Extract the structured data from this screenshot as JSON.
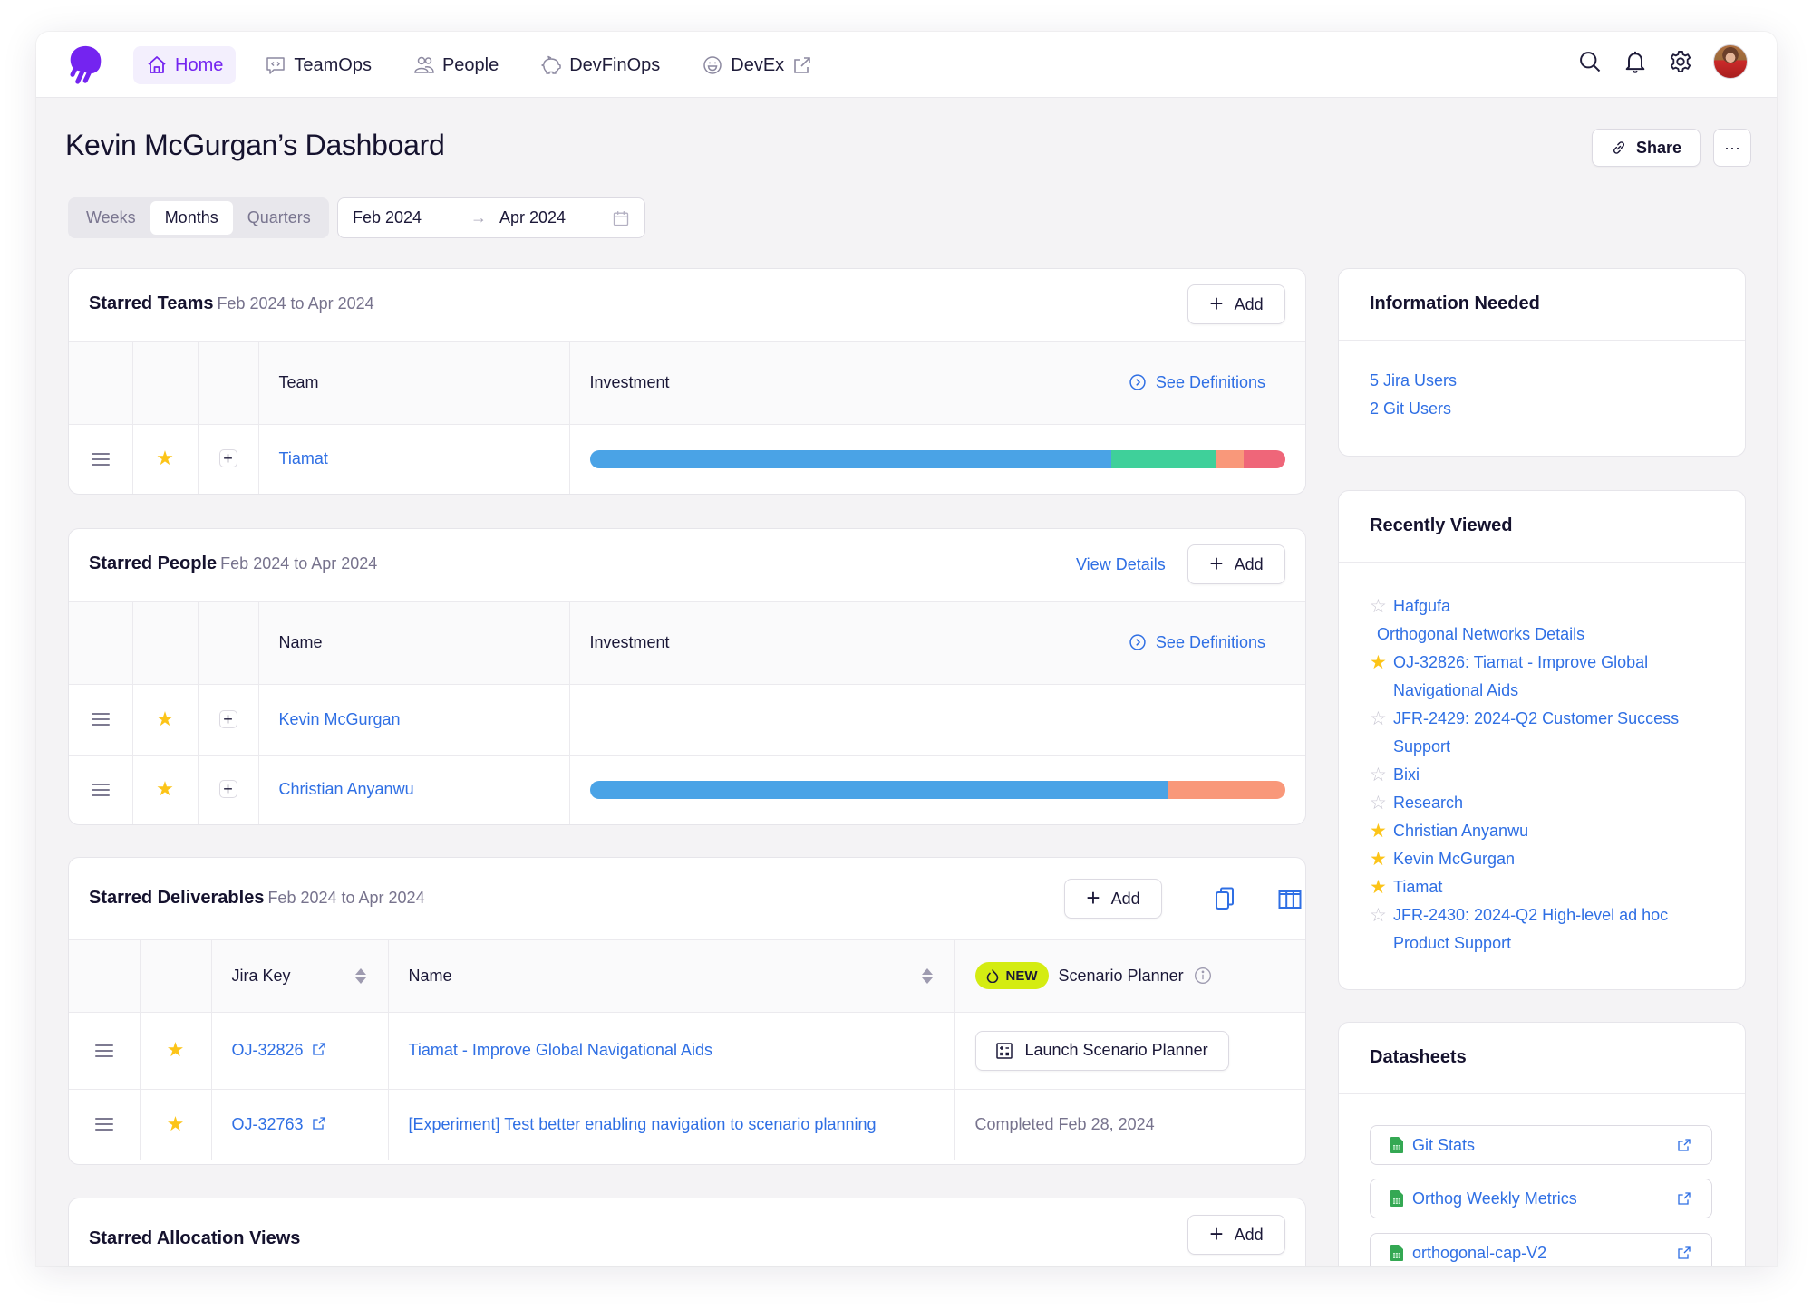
{
  "nav": {
    "items": [
      {
        "label": "Home",
        "icon": "home-icon",
        "active": true
      },
      {
        "label": "TeamOps",
        "icon": "code-chat-icon",
        "active": false
      },
      {
        "label": "People",
        "icon": "people-icon",
        "active": false
      },
      {
        "label": "DevFinOps",
        "icon": "piggy-bank-icon",
        "active": false
      },
      {
        "label": "DevEx",
        "icon": "smiley-icon",
        "active": false,
        "external": true
      }
    ],
    "right_icons": [
      "search-icon",
      "bell-icon",
      "gear-icon",
      "avatar"
    ]
  },
  "page": {
    "title": "Kevin McGurgan’s Dashboard",
    "share_label": "Share",
    "more_label": "···"
  },
  "period": {
    "options": [
      "Weeks",
      "Months",
      "Quarters"
    ],
    "selected": "Months",
    "start": "Feb 2024",
    "arrow": "→",
    "end": "Apr 2024"
  },
  "colors": {
    "accent": "#7424f0",
    "link": "#2f6fe4",
    "star": "#fcc418",
    "bar_blue": "#4aa3e6",
    "bar_green": "#3fd09a",
    "bar_orange": "#f9987a",
    "bar_red": "#ef6679",
    "new_badge": "#d4ec12"
  },
  "teams": {
    "title": "Starred Teams",
    "range": "Feb 2024 to Apr 2024",
    "add_label": "Add",
    "columns": {
      "team": "Team",
      "investment": "Investment",
      "see_definitions": "See Definitions"
    },
    "rows": [
      {
        "name": "Tiamat",
        "starred": true,
        "investment": [
          {
            "category": "blue",
            "fraction": 0.75
          },
          {
            "category": "green",
            "fraction": 0.15
          },
          {
            "category": "orange",
            "fraction": 0.04
          },
          {
            "category": "red",
            "fraction": 0.06
          }
        ]
      }
    ]
  },
  "people": {
    "title": "Starred People",
    "range": "Feb 2024 to Apr 2024",
    "view_details_label": "View Details",
    "add_label": "Add",
    "columns": {
      "name": "Name",
      "investment": "Investment",
      "see_definitions": "See Definitions"
    },
    "rows": [
      {
        "name": "Kevin McGurgan",
        "starred": true,
        "investment": []
      },
      {
        "name": "Christian Anyanwu",
        "starred": true,
        "investment": [
          {
            "category": "blue",
            "fraction": 0.83
          },
          {
            "category": "orange",
            "fraction": 0.17
          }
        ]
      }
    ]
  },
  "deliverables": {
    "title": "Starred Deliverables",
    "range": "Feb 2024 to Apr 2024",
    "add_label": "Add",
    "columns": {
      "jira_key": "Jira Key",
      "name": "Name",
      "new_badge": "NEW",
      "scenario_planner": "Scenario Planner"
    },
    "rows": [
      {
        "jira_key": "OJ-32826",
        "name": "Tiamat - Improve Global Navigational Aids",
        "starred": true,
        "action": "Launch Scenario Planner",
        "status": null
      },
      {
        "jira_key": "OJ-32763",
        "name": "[Experiment] Test better enabling navigation to scenario planning",
        "starred": true,
        "action": null,
        "status": "Completed Feb 28, 2024"
      }
    ]
  },
  "allocation": {
    "title": "Starred Allocation Views",
    "add_label": "Add"
  },
  "info_needed": {
    "title": "Information Needed",
    "links": [
      "5 Jira Users",
      "2 Git Users"
    ]
  },
  "recently_viewed": {
    "title": "Recently Viewed",
    "items": [
      {
        "label": "Hafgufa",
        "star": "off"
      },
      {
        "label": "Orthogonal Networks Details",
        "star": "none"
      },
      {
        "label": "OJ-32826: Tiamat - Improve Global Navigational Aids",
        "star": "on"
      },
      {
        "label": "JFR-2429: 2024-Q2 Customer Success Support",
        "star": "off"
      },
      {
        "label": "Bixi",
        "star": "off"
      },
      {
        "label": "Research",
        "star": "off"
      },
      {
        "label": "Christian Anyanwu",
        "star": "on"
      },
      {
        "label": "Kevin McGurgan",
        "star": "on"
      },
      {
        "label": "Tiamat",
        "star": "on"
      },
      {
        "label": "JFR-2430: 2024-Q2 High-level ad hoc Product Support",
        "star": "off"
      }
    ]
  },
  "datasheets": {
    "title": "Datasheets",
    "items": [
      "Git Stats",
      "Orthog Weekly Metrics",
      "orthogonal-cap-V2"
    ]
  }
}
